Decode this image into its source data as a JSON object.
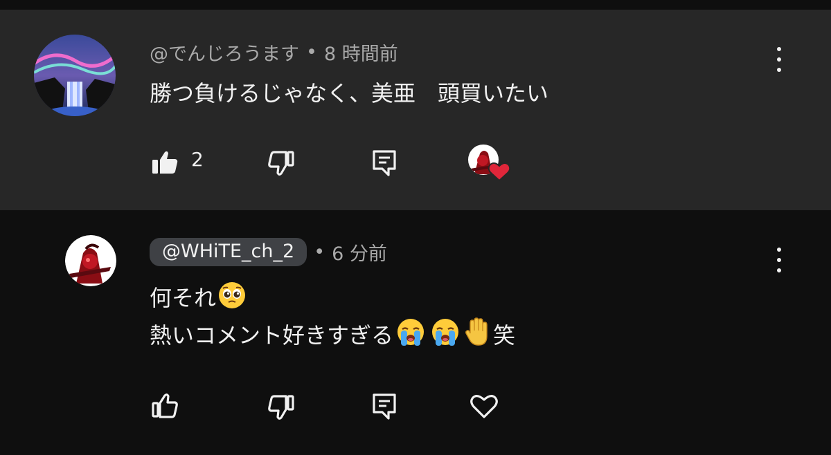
{
  "comments": [
    {
      "handle": "@でんじろうます",
      "separator": "•",
      "time": "8 時間前",
      "text": "勝つ負けるじゃなく、美亜　頭買いたい",
      "likes": "2",
      "liked": true,
      "creator_hearted": true
    },
    {
      "handle": "@WHiTE_ch_2",
      "separator": "•",
      "time": "6 分前",
      "lines": [
        "何それ",
        "熱いコメント好きすぎる",
        "笑"
      ],
      "liked": false,
      "creator_hearted": false
    }
  ],
  "colors": {
    "highlight_bg": "#272727",
    "page_bg": "#0f0f0f",
    "text": "#f1f1f1",
    "meta": "#aaaaaa",
    "handle_pill": "#3f4145",
    "heart": "#e0263a"
  },
  "icons": [
    "thumb-up-filled-icon",
    "thumb-down-icon",
    "reply-icon",
    "creator-heart-icon",
    "thumb-up-icon",
    "heart-outline-icon",
    "more-vert-icon",
    "pleading-face-emoji",
    "loudly-crying-face-emoji",
    "raised-hand-emoji"
  ]
}
